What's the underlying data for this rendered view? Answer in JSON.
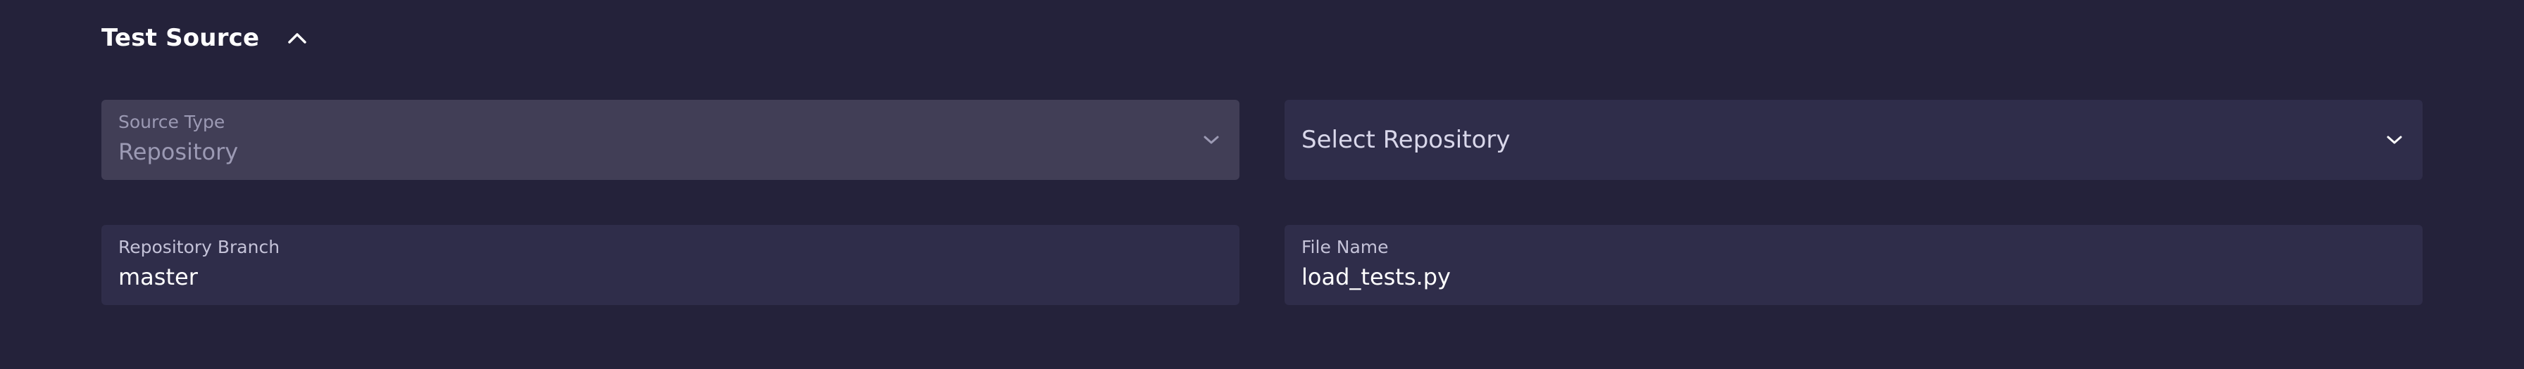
{
  "section": {
    "title": "Test Source"
  },
  "source_type": {
    "label": "Source Type",
    "value": "Repository"
  },
  "repository": {
    "placeholder": "Select Repository"
  },
  "branch": {
    "label": "Repository Branch",
    "value": "master"
  },
  "file_name": {
    "label": "File Name",
    "value": "load_tests.py"
  },
  "icons": {
    "collapse": "chevron-up-icon",
    "source_dropdown": "chevron-down-icon",
    "repository_dropdown": "chevron-down-icon"
  },
  "colors": {
    "background": "#24223a",
    "field_disabled": "#413e56",
    "field_active": "#2f2d4a"
  }
}
